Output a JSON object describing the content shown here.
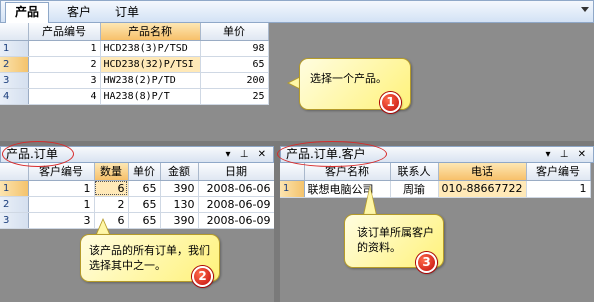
{
  "top_tabs": [
    {
      "label": "产品",
      "active": true
    },
    {
      "label": "客户",
      "active": false
    },
    {
      "label": "订单",
      "active": false
    }
  ],
  "products": {
    "columns": [
      "产品编号",
      "产品名称",
      "单价"
    ],
    "rows": [
      {
        "rownum": "1",
        "id": "1",
        "name": "HCD238(3)P/TSD",
        "price": "98"
      },
      {
        "rownum": "2",
        "id": "2",
        "name": "HCD238(32)P/TSI",
        "price": "65"
      },
      {
        "rownum": "3",
        "id": "3",
        "name": "HW238(2)P/TD",
        "price": "200"
      },
      {
        "rownum": "4",
        "id": "4",
        "name": "HA238(8)P/T",
        "price": "25"
      }
    ]
  },
  "orders_pane": {
    "title": "产品.订单",
    "buttons": "▾ ⊥ ✕",
    "columns": [
      "客户编号",
      "数量",
      "单价",
      "金额",
      "日期"
    ],
    "rows": [
      {
        "rownum": "1",
        "customer_id": "1",
        "qty": "6",
        "price": "65",
        "amount": "390",
        "date": "2008-06-06"
      },
      {
        "rownum": "2",
        "customer_id": "1",
        "qty": "2",
        "price": "65",
        "amount": "130",
        "date": "2008-06-09"
      },
      {
        "rownum": "3",
        "customer_id": "3",
        "qty": "6",
        "price": "65",
        "amount": "390",
        "date": "2008-06-09"
      }
    ]
  },
  "customer_pane": {
    "title": "产品.订单.客户",
    "buttons": "▾ ⊥ ✕",
    "columns": [
      "客户名称",
      "联系人",
      "电话",
      "客户编号"
    ],
    "rows": [
      {
        "rownum": "1",
        "name": "联想电脑公司",
        "contact": "周瑜",
        "phone": "010-88667722",
        "customer_id": "1"
      }
    ]
  },
  "callouts": [
    {
      "text": "选择一个产品。",
      "badge": "1"
    },
    {
      "text": "该产品的所有订单，我们选择其中之一。",
      "badge": "2"
    },
    {
      "text": "该订单所属客户的资料。",
      "badge": "3"
    }
  ],
  "colors": {
    "accent_red": "#d82a2a",
    "callout_yellow": "#fff27a",
    "selection_orange": "#f7c06a"
  }
}
